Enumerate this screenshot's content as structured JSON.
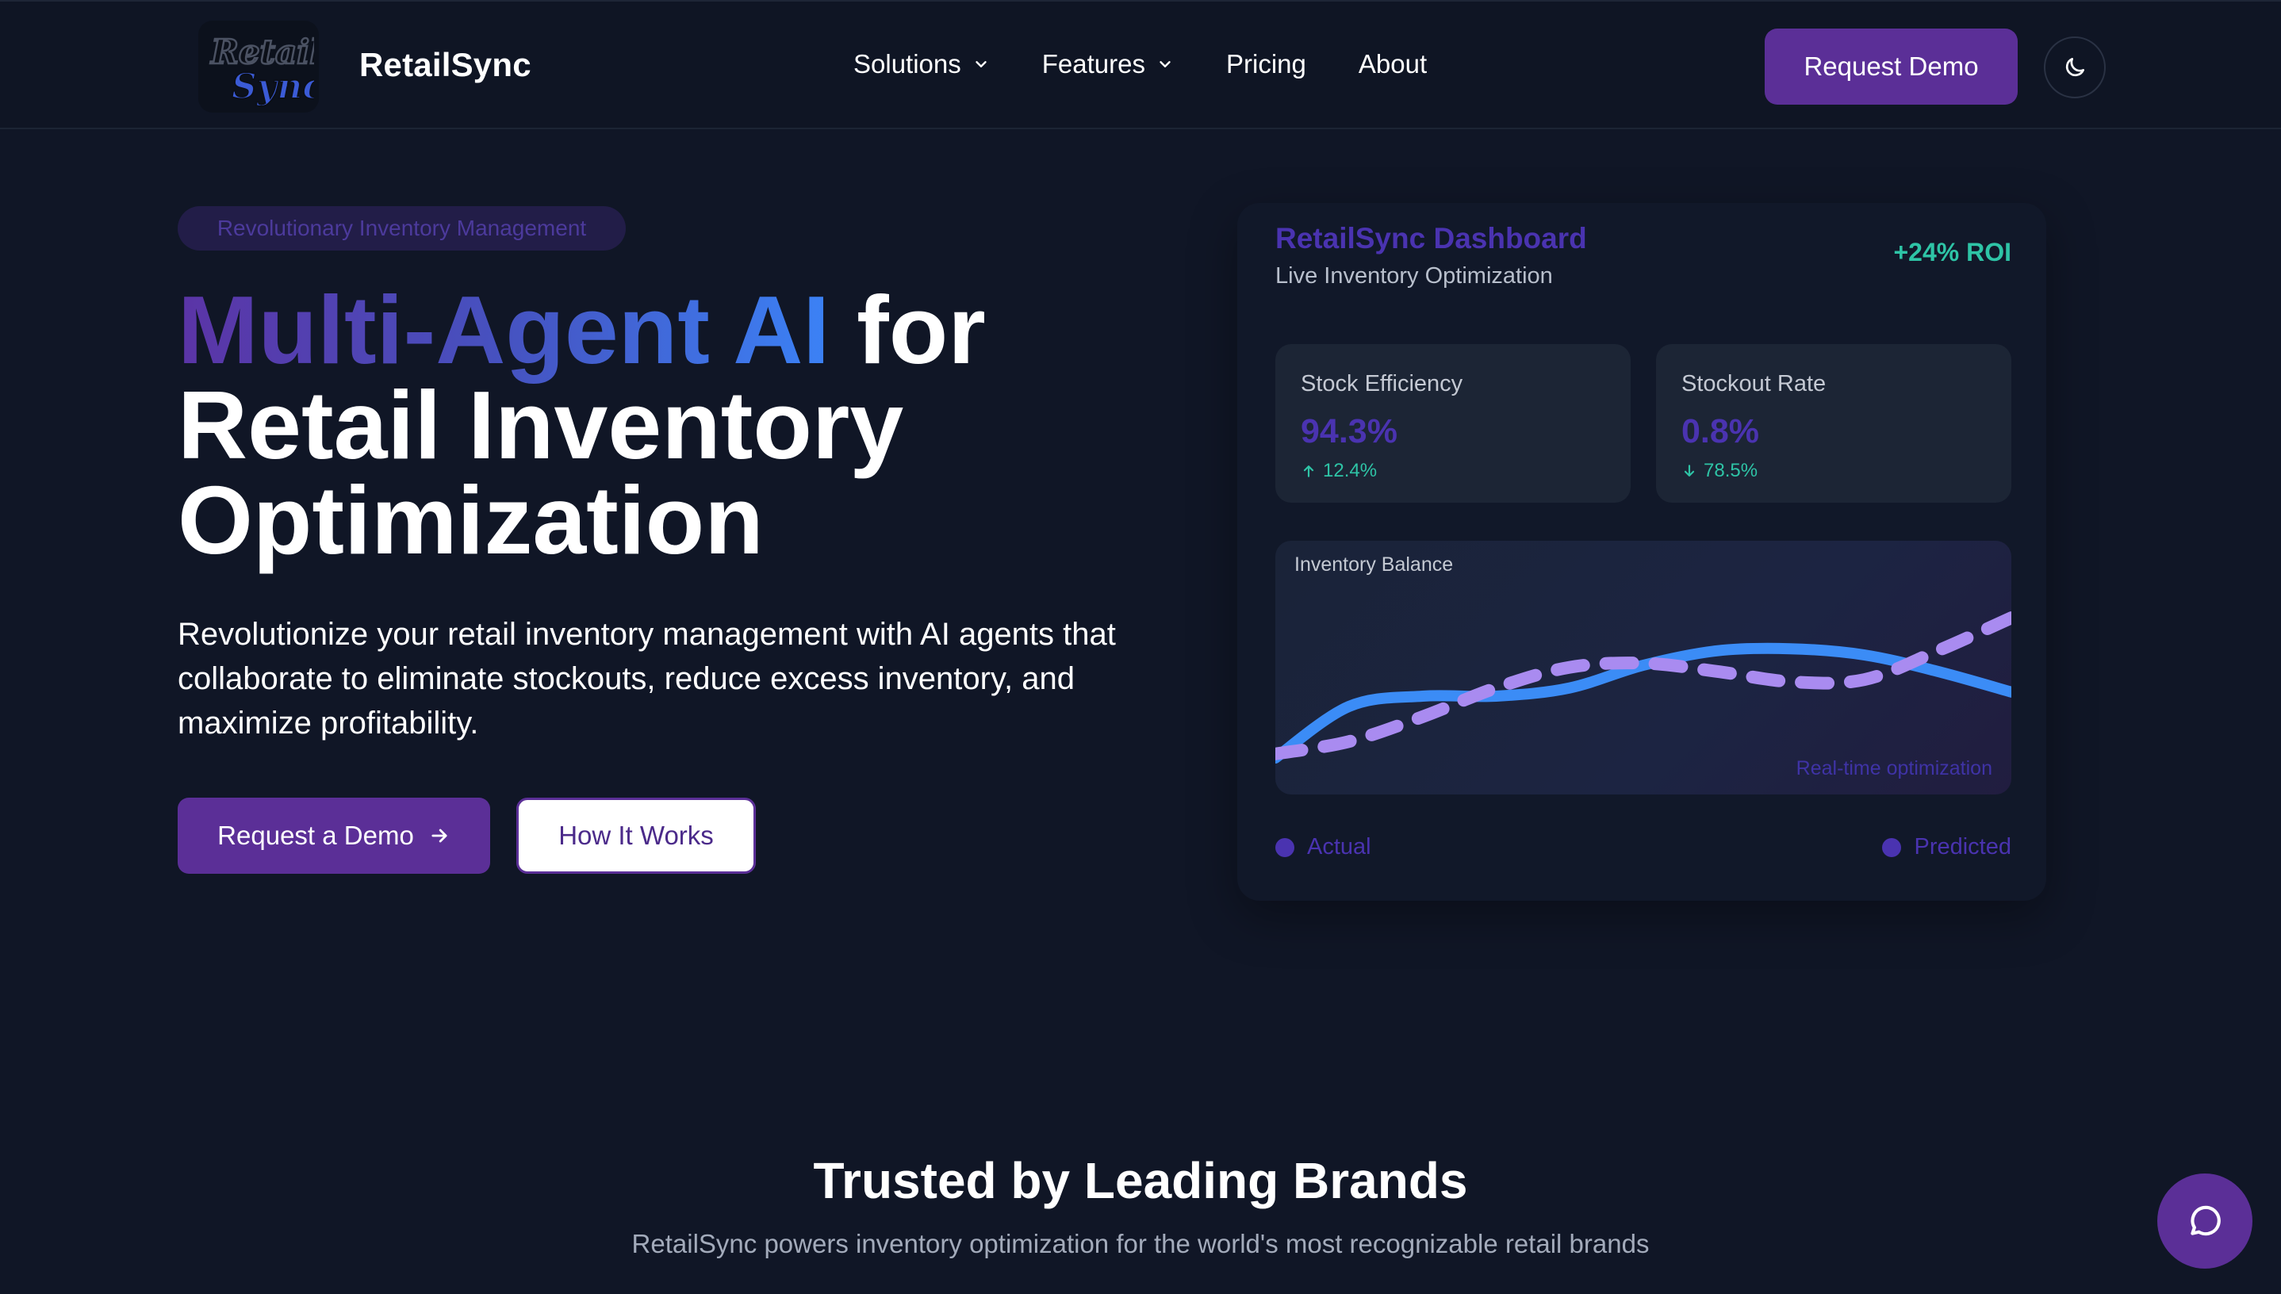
{
  "nav": {
    "logo_text": "Retail Sync",
    "brand": "RetailSync",
    "links": [
      {
        "label": "Solutions",
        "has_dropdown": true
      },
      {
        "label": "Features",
        "has_dropdown": true
      },
      {
        "label": "Pricing",
        "has_dropdown": false
      },
      {
        "label": "About",
        "has_dropdown": false
      }
    ],
    "cta": "Request Demo",
    "theme_icon": "moon-icon"
  },
  "hero": {
    "tag": "Revolutionary Inventory Management",
    "title_gradient": "Multi-Agent AI",
    "title_rest_line1": " for",
    "title_line2": "Retail Inventory",
    "title_line3": "Optimization",
    "subtitle": "Revolutionize your retail inventory management with AI agents that collaborate to eliminate stockouts, reduce excess inventory, and maximize profitability.",
    "primary_cta": "Request a Demo",
    "secondary_cta": "How It Works"
  },
  "dashboard": {
    "title": "RetailSync Dashboard",
    "subtitle": "Live Inventory Optimization",
    "roi": "+24% ROI",
    "stats": [
      {
        "label": "Stock Efficiency",
        "value": "94.3%",
        "delta": "12.4%",
        "direction": "up"
      },
      {
        "label": "Stockout Rate",
        "value": "0.8%",
        "delta": "78.5%",
        "direction": "down"
      }
    ],
    "chart_title": "Inventory Balance",
    "chart_note": "Real-time optimization",
    "legend": [
      "Actual",
      "Predicted"
    ]
  },
  "chart_data": {
    "type": "line",
    "title": "Inventory Balance",
    "xlabel": "",
    "ylabel": "",
    "grid": false,
    "legend_position": "bottom",
    "x": [
      0,
      1,
      2,
      3,
      4,
      5,
      6,
      7,
      8,
      9,
      10
    ],
    "ylim": [
      0,
      100
    ],
    "series": [
      {
        "name": "Actual",
        "style": "solid",
        "color": "#3b8cf6",
        "values": [
          10,
          35,
          40,
          40,
          44,
          55,
          62,
          63,
          60,
          52,
          42
        ]
      },
      {
        "name": "Predicted",
        "style": "dashed",
        "color": "#a98bf0",
        "values": [
          12,
          18,
          30,
          44,
          54,
          56,
          52,
          47,
          48,
          62,
          78
        ]
      }
    ]
  },
  "trusted": {
    "title": "Trusted by Leading Brands",
    "subtitle": "RetailSync powers inventory optimization for the world's most recognizable retail brands"
  },
  "chat": {
    "icon": "chat-bubble-icon"
  },
  "colors": {
    "background": "#101626",
    "accent": "#5b2f97",
    "gradient_start": "#5b34a6",
    "gradient_end": "#3b82f6",
    "positive": "#2ec4a6"
  }
}
